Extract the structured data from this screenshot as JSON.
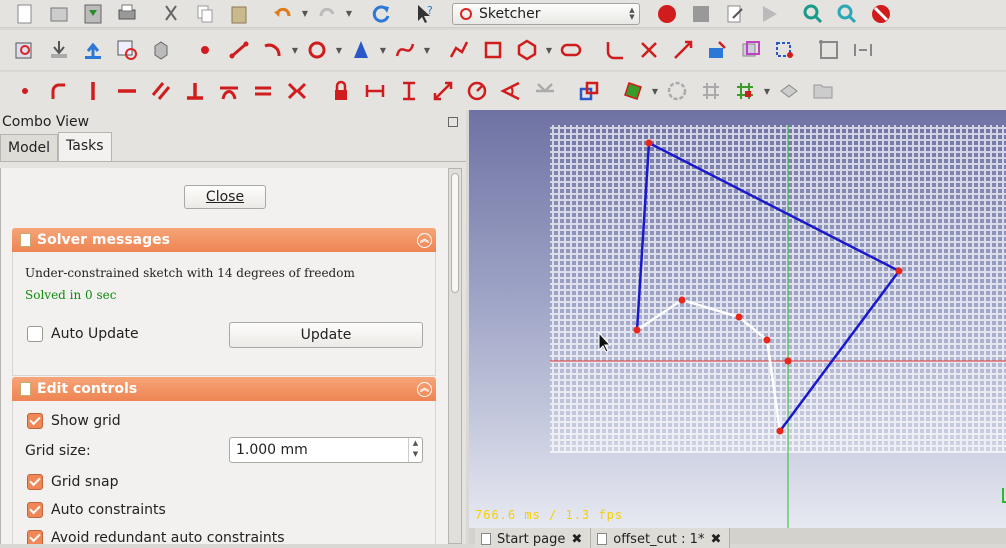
{
  "toolbar": {
    "workbench": "Sketcher"
  },
  "combo_view": {
    "title": "Combo View",
    "tabs": [
      "Model",
      "Tasks"
    ],
    "active_tab": "Tasks",
    "close_label": "Close",
    "solver": {
      "title": "Solver messages",
      "message": "Under-constrained sketch with 14 degrees of freedom",
      "status": "Solved in 0 sec",
      "auto_update_label": "Auto Update",
      "auto_update_checked": false,
      "update_label": "Update"
    },
    "edit_controls": {
      "title": "Edit controls",
      "show_grid_label": "Show grid",
      "grid_size_label": "Grid size:",
      "grid_size_value": "1.000 mm",
      "grid_snap_label": "Grid snap",
      "auto_constraints_label": "Auto constraints",
      "avoid_redundant_label": "Avoid redundant auto constraints"
    }
  },
  "viewport": {
    "fps": "766.6 ms / 1.3 fps"
  },
  "doc_tabs": [
    {
      "label": "Start page"
    },
    {
      "label": "offset_cut : 1*"
    }
  ],
  "colors": {
    "accent": "#ee8453",
    "construction_line": "#1a1aff",
    "sketch_line": "#ffffff",
    "vertex": "#e8261c"
  }
}
